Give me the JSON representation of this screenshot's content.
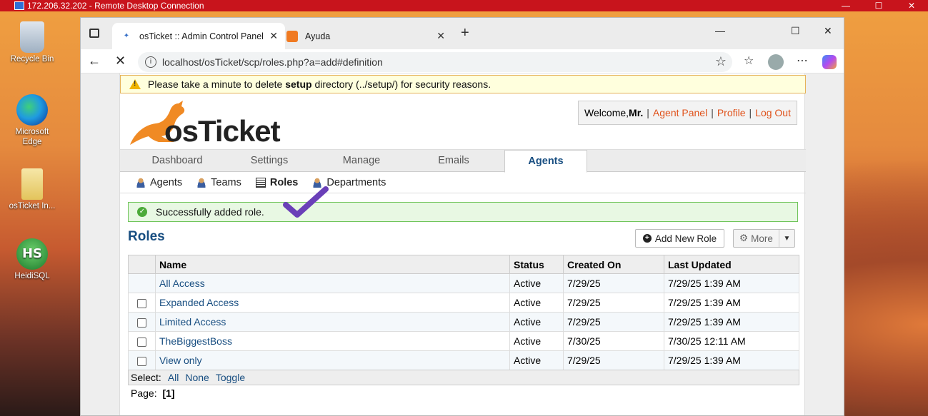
{
  "rdp": {
    "title": "172.206.32.202 - Remote Desktop Connection",
    "controls": [
      "—",
      "☐",
      "✕"
    ]
  },
  "desktop": {
    "icons": [
      {
        "label": "Recycle Bin"
      },
      {
        "label": "Microsoft Edge"
      },
      {
        "label": "osTicket In..."
      },
      {
        "label": "HeidiSQL",
        "glyph": "HS"
      }
    ]
  },
  "browser": {
    "tabs": [
      {
        "label": "osTicket :: Admin Control Panel",
        "active": true
      },
      {
        "label": "Ayuda",
        "active": false
      }
    ],
    "url": "localhost/osTicket/scp/roles.php?a=add#definition",
    "loading": true
  },
  "page": {
    "warning": {
      "before": "Please take a minute to delete ",
      "bold": "setup",
      "after": " directory (../setup/) for security reasons."
    },
    "logo_text": "osTicket",
    "welcome": {
      "prefix": "Welcome, ",
      "user": "Mr.",
      "links": [
        "Agent Panel",
        "Profile",
        "Log Out"
      ]
    },
    "main_tabs": [
      {
        "label": "Dashboard",
        "active": false
      },
      {
        "label": "Settings",
        "active": false
      },
      {
        "label": "Manage",
        "active": false
      },
      {
        "label": "Emails",
        "active": false
      },
      {
        "label": "Agents",
        "active": true
      }
    ],
    "sub_nav": [
      {
        "label": "Agents",
        "icon": "agent-icon",
        "active": false
      },
      {
        "label": "Teams",
        "icon": "teams-icon",
        "active": false
      },
      {
        "label": "Roles",
        "icon": "roles-list-icon",
        "active": true
      },
      {
        "label": "Departments",
        "icon": "departments-icon",
        "active": false
      }
    ],
    "success_message": "Successfully added role.",
    "title": "Roles",
    "buttons": {
      "add_role": "Add New Role",
      "more": "More"
    },
    "table": {
      "columns": [
        "Name",
        "Status",
        "Created On",
        "Last Updated"
      ],
      "rows": [
        {
          "name": "All Access",
          "status": "Active",
          "created": "7/29/25",
          "updated": "7/29/25 1:39 AM",
          "checkbox": false
        },
        {
          "name": "Expanded Access",
          "status": "Active",
          "created": "7/29/25",
          "updated": "7/29/25 1:39 AM",
          "checkbox": true
        },
        {
          "name": "Limited Access",
          "status": "Active",
          "created": "7/29/25",
          "updated": "7/29/25 1:39 AM",
          "checkbox": true
        },
        {
          "name": "TheBiggestBoss",
          "status": "Active",
          "created": "7/30/25",
          "updated": "7/30/25 12:11 AM",
          "checkbox": true
        },
        {
          "name": "View only",
          "status": "Active",
          "created": "7/29/25",
          "updated": "7/29/25 1:39 AM",
          "checkbox": true
        }
      ]
    },
    "select": {
      "label": "Select:",
      "options": [
        "All",
        "None",
        "Toggle"
      ]
    },
    "pager": {
      "label": "Page:",
      "current": "[1]"
    }
  },
  "colors": {
    "rdp_bar": "#c8141c",
    "link": "#184e81",
    "welcome_link": "#e0531c",
    "success_border": "#6fc45a",
    "warning_bg": "#ffffdd"
  }
}
